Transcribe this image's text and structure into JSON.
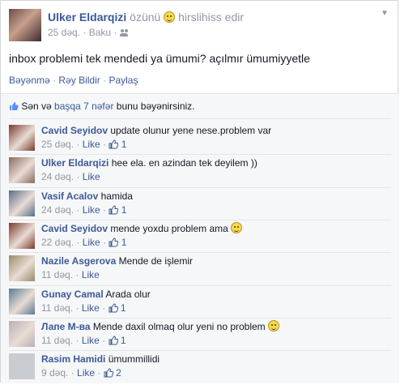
{
  "post": {
    "author": "Ulker Eldarqizi",
    "feeling_prefix": "özünü",
    "feeling": "hirslihiss edir",
    "time": "25 dəq.",
    "location": "Baku",
    "text": "inbox problemi tek mendedi ya ümumi? açılmır ümumiyyetle",
    "actions": [
      "Bəyənmə",
      "Rəy Bildir",
      "Paylaş"
    ],
    "likes_prefix": "Sən və",
    "likes_link": "başqa 7 nəfər",
    "likes_suffix": "bunu bəyənirsiniz."
  },
  "comments": [
    {
      "name": "Cavid Seyidov",
      "text": "update olunur yene nese.problem var",
      "time": "25 dəq.",
      "like": "Like",
      "likes": "1",
      "emoji": false,
      "avatar_color": "#7a3b2e"
    },
    {
      "name": "Ulker Eldarqizi",
      "text": "hee ela. en azindan tek deyilem ))",
      "time": "24 dəq.",
      "like": "Like",
      "likes": "",
      "emoji": false,
      "avatar_color": "#8a6a60"
    },
    {
      "name": "Vasif Acalov",
      "text": "hamida",
      "time": "24 dəq.",
      "like": "Like",
      "likes": "1",
      "emoji": false,
      "avatar_color": "#5a6c8a"
    },
    {
      "name": "Cavid Seyidov",
      "text": "mende yoxdu problem ama",
      "time": "22 dəq.",
      "like": "Like",
      "likes": "1",
      "emoji": true,
      "avatar_color": "#7a3b2e"
    },
    {
      "name": "Nazile Asgerova",
      "text": "Mende de işlemir",
      "time": "11 dəq.",
      "like": "Like",
      "likes": "",
      "emoji": false,
      "avatar_color": "#9a8a6a"
    },
    {
      "name": "Gunay Camal",
      "text": "Arada olur",
      "time": "11 dəq.",
      "like": "Like",
      "likes": "1",
      "emoji": false,
      "avatar_color": "#5c7a92"
    },
    {
      "name": "Лапе М-ва",
      "text": "Mende daxil olmaq olur yeni no problem",
      "time": "11 dəq.",
      "like": "Like",
      "likes": "1",
      "emoji": true,
      "avatar_color": "#b8b0b8"
    },
    {
      "name": "Rasim Hamidi",
      "text": "ümummillidi",
      "time": "9 dəq.",
      "like": "Like",
      "likes": "2",
      "emoji": false,
      "avatar_color": "#c9ccd1"
    }
  ],
  "colors": {
    "link": "#3b5998",
    "muted": "#9197a3",
    "ufi_bg": "#f6f7f8"
  },
  "icons": {
    "feeling": "annoyed-emoji-icon",
    "audience": "friends-icon",
    "like": "thumbs-up-icon",
    "menu": "chevron-down-icon"
  }
}
